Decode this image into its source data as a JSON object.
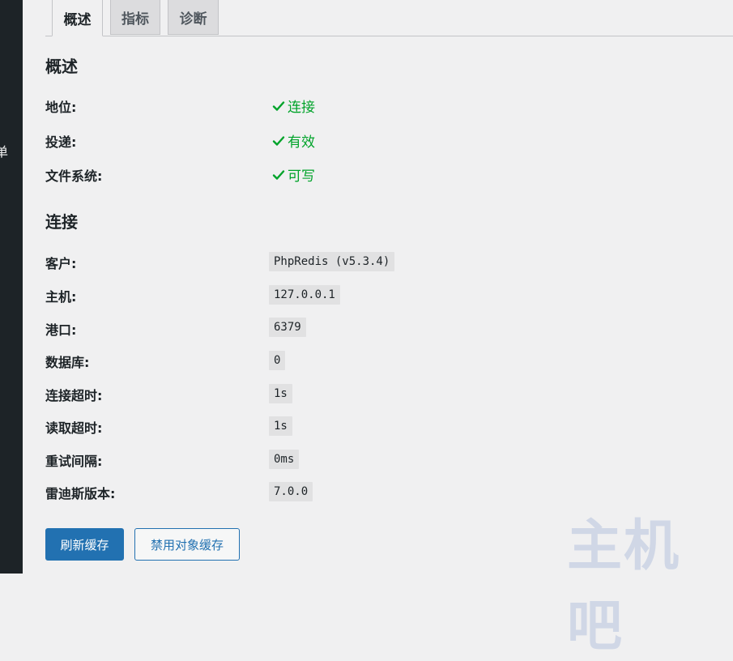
{
  "sidebar": {
    "partial_label": "单"
  },
  "tabs": [
    {
      "label": "概述",
      "active": true
    },
    {
      "label": "指标",
      "active": false
    },
    {
      "label": "诊断",
      "active": false
    }
  ],
  "overview": {
    "title": "概述",
    "rows": [
      {
        "label": "地位:",
        "value": "连接",
        "icon": "checkmark-icon"
      },
      {
        "label": "投递:",
        "value": "有效",
        "icon": "checkmark-icon"
      },
      {
        "label": "文件系统:",
        "value": "可写",
        "icon": "checkmark-icon"
      }
    ]
  },
  "connection": {
    "title": "连接",
    "rows": [
      {
        "label": "客户:",
        "value": "PhpRedis (v5.3.4)"
      },
      {
        "label": "主机:",
        "value": "127.0.0.1"
      },
      {
        "label": "港口:",
        "value": "6379"
      },
      {
        "label": "数据库:",
        "value": "0"
      },
      {
        "label": "连接超时:",
        "value": "1s"
      },
      {
        "label": "读取超时:",
        "value": "1s"
      },
      {
        "label": "重试间隔:",
        "value": "0ms"
      },
      {
        "label": "雷迪斯版本:",
        "value": "7.0.0"
      }
    ]
  },
  "buttons": {
    "flush": "刷新缓存",
    "disable": "禁用对象缓存"
  },
  "watermark": "主机吧",
  "colors": {
    "sidebar": "#1d2327",
    "background": "#f0f0f1",
    "primary": "#2271b1",
    "success": "#00a32a"
  }
}
